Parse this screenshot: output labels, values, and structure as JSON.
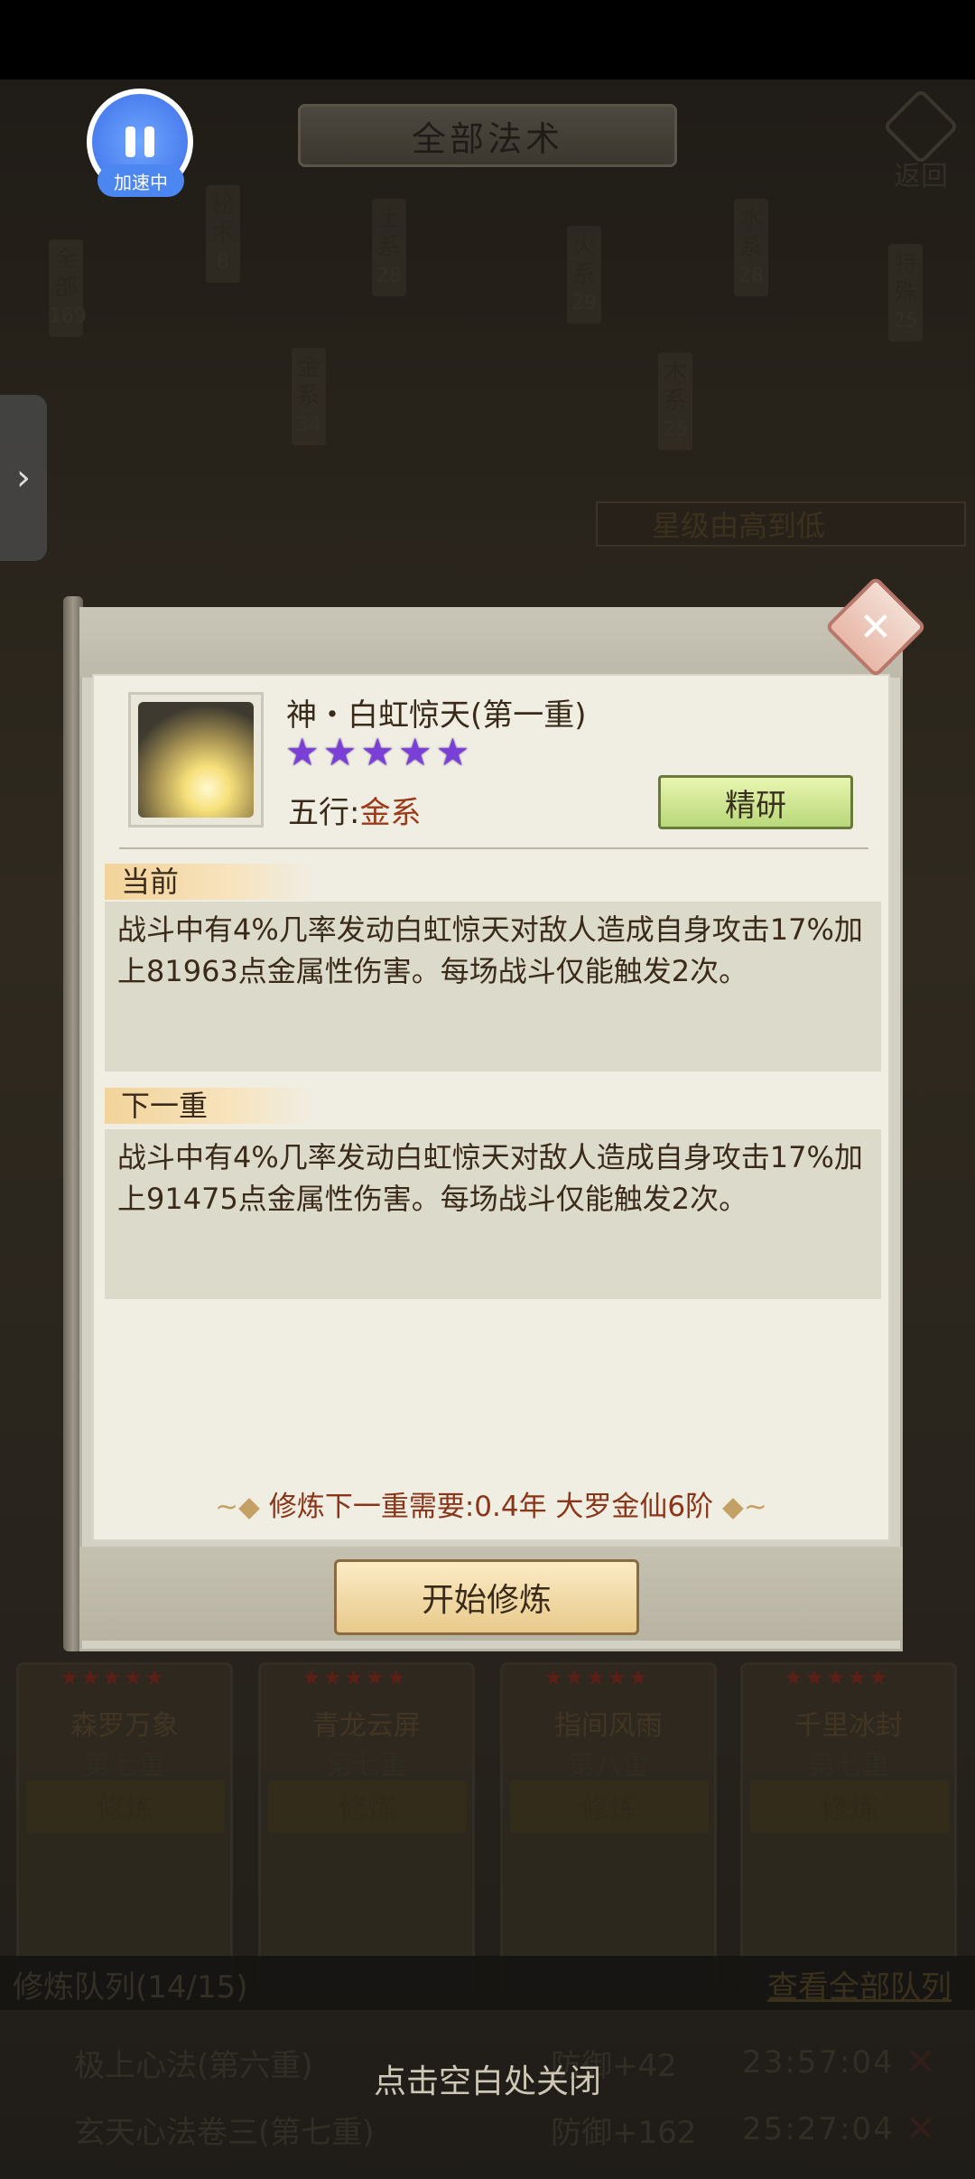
{
  "header": {
    "title": "全部法术",
    "back_label": "返回"
  },
  "pause_badge": {
    "label": "加速中"
  },
  "categories": [
    {
      "label": "全部",
      "count": "169"
    },
    {
      "label": "秘术",
      "count": "8"
    },
    {
      "label": "金系",
      "count": "34"
    },
    {
      "label": "土系",
      "count": "28"
    },
    {
      "label": "火系",
      "count": "29"
    },
    {
      "label": "木系",
      "count": "25"
    },
    {
      "label": "水系",
      "count": "28"
    },
    {
      "label": "特殊",
      "count": "25"
    }
  ],
  "sort": {
    "label": "星级由高到低"
  },
  "cards": [
    {
      "name": "森罗万象",
      "level": "第七重",
      "button": "修炼"
    },
    {
      "name": "青龙云屏",
      "level": "第七重",
      "button": "修炼"
    },
    {
      "name": "指间风雨",
      "level": "第八重",
      "button": "修炼"
    },
    {
      "name": "千里冰封",
      "level": "第七重",
      "button": "修炼"
    }
  ],
  "modal": {
    "skill_name": "神・白虹惊天(第一重)",
    "stars": 5,
    "element_label": "五行:",
    "element_value": "金系",
    "refine_button": "精研",
    "current_tag": "当前",
    "current_text": "战斗中有4%几率发动白虹惊天对敌人造成自身攻击17%加上81963点金属性伤害。每场战斗仅能触发2次。",
    "next_tag": "下一重",
    "next_text": "战斗中有4%几率发动白虹惊天对敌人造成自身攻击17%加上91475点金属性伤害。每场战斗仅能触发2次。",
    "requirement": "修炼下一重需要:0.4年 大罗金仙6阶",
    "start_button": "开始修炼"
  },
  "queue": {
    "title": "修炼队列(14/15)",
    "view_all": "查看全部队列",
    "items": [
      {
        "name": "极上心法(第六重)",
        "effect": "防御+42",
        "time": "23:57:04"
      },
      {
        "name": "玄天心法卷三(第七重)",
        "effect": "防御+162",
        "time": "25:27:04"
      }
    ]
  },
  "close_hint": "点击空白处关闭"
}
